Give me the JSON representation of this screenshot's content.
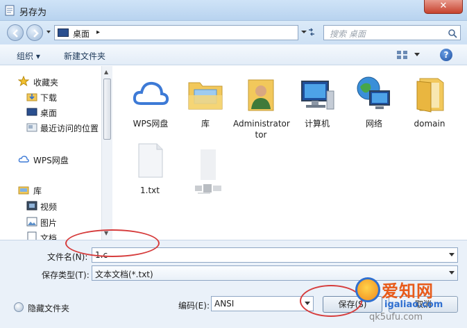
{
  "window": {
    "title": "另存为",
    "close_label": "✕"
  },
  "address_bar": {
    "location": "桌面",
    "separator": "▸",
    "refresh_icon": "refresh-icon"
  },
  "search": {
    "placeholder": "搜索 桌面"
  },
  "toolbar": {
    "organize_label": "组织 ▾",
    "new_folder_label": "新建文件夹",
    "help_label": "?"
  },
  "nav_pane": {
    "items": [
      {
        "label": "收藏夹",
        "icon": "star-icon"
      },
      {
        "label": "下载",
        "icon": "download-folder-icon"
      },
      {
        "label": "桌面",
        "icon": "desktop-icon"
      },
      {
        "label": "最近访问的位置",
        "icon": "recent-places-icon"
      },
      {
        "label": "WPS网盘",
        "icon": "cloud-icon"
      },
      {
        "label": "库",
        "icon": "library-icon"
      },
      {
        "label": "视频",
        "icon": "video-icon"
      },
      {
        "label": "图片",
        "icon": "picture-icon"
      },
      {
        "label": "文档",
        "icon": "document-icon"
      }
    ]
  },
  "files": [
    {
      "name": "WPS网盘",
      "icon": "cloud-icon"
    },
    {
      "name": "库",
      "icon": "library-folder-icon"
    },
    {
      "name": "Administrator",
      "name2": "tor",
      "icon": "user-folder-icon"
    },
    {
      "name": "计算机",
      "icon": "computer-icon"
    },
    {
      "name": "网络",
      "icon": "network-icon"
    },
    {
      "name": "domain",
      "icon": "folder-icon"
    },
    {
      "name": "1.txt",
      "icon": "text-file-icon"
    },
    {
      "name": "",
      "icon": "blurred-file-icon"
    }
  ],
  "form": {
    "filename_label": "文件名(N):",
    "filename_value": "1.c",
    "filetype_label": "保存类型(T):",
    "filetype_value": "文本文档(*.txt)",
    "hide_folders_label": "隐藏文件夹",
    "encoding_label": "编码(E):",
    "encoding_value": "ANSI",
    "save_label": "保存(S)",
    "cancel_label": "取消"
  },
  "watermark": {
    "title": "爱知网",
    "site": "igaliao.com",
    "site2": "qk5ufu.com"
  },
  "colors": {
    "accent": "#2f6fd0",
    "annotation": "#d63c3c",
    "close": "#c6422e"
  }
}
